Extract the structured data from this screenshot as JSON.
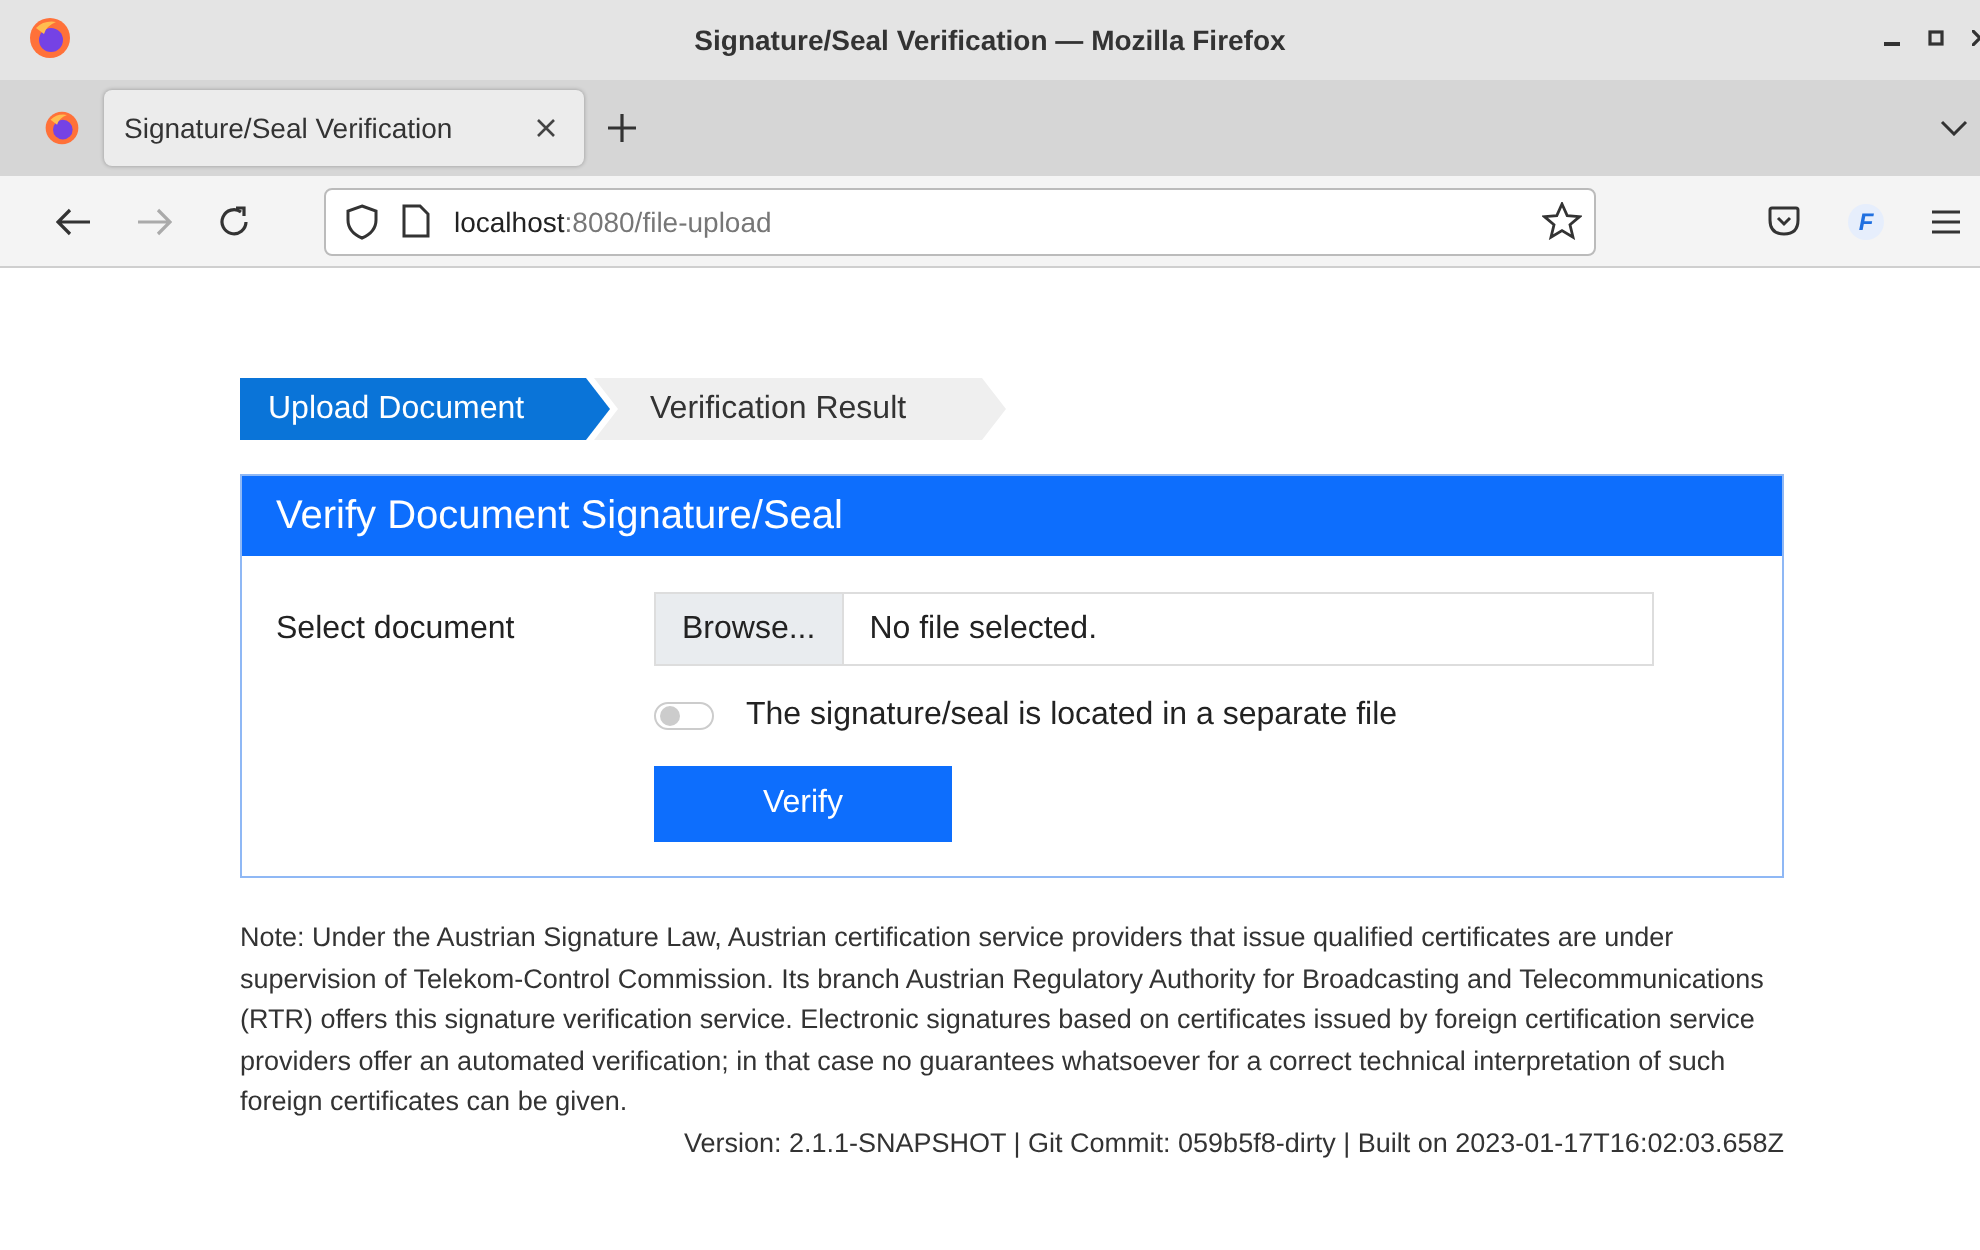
{
  "window": {
    "title": "Signature/Seal Verification — Mozilla Firefox"
  },
  "tabs": [
    {
      "label": "Signature/Seal Verification",
      "selected": true
    }
  ],
  "address_bar": {
    "host": "localhost",
    "path": ":8080/file-upload"
  },
  "account_badge": "F",
  "steps": [
    {
      "label": "Upload Document",
      "selected": true
    },
    {
      "label": "Verification Result",
      "selected": false
    }
  ],
  "card": {
    "title": "Verify Document Signature/Seal",
    "field_label": "Select document",
    "browse_button": "Browse...",
    "file_status": "No file selected.",
    "separate_file_toggle": {
      "label": "The signature/seal is located in a separate file",
      "on": false
    },
    "submit_button": "Verify"
  },
  "note": "Note: Under the Austrian Signature Law, Austrian certification service providers that issue qualified certificates are under supervision of Telekom-Control Commission. Its branch Austrian Regulatory Authority for Broadcasting and Telecommunications (RTR) offers this signature verification service. Electronic signatures based on certificates issued by foreign certification service providers offer an automated verification; in that case no guarantees whatsoever for a correct technical interpretation of such foreign certificates can be given.",
  "version_line": "Version: 2.1.1-SNAPSHOT | Git Commit: 059b5f8-dirty | Built on 2023-01-17T16:02:03.658Z"
}
